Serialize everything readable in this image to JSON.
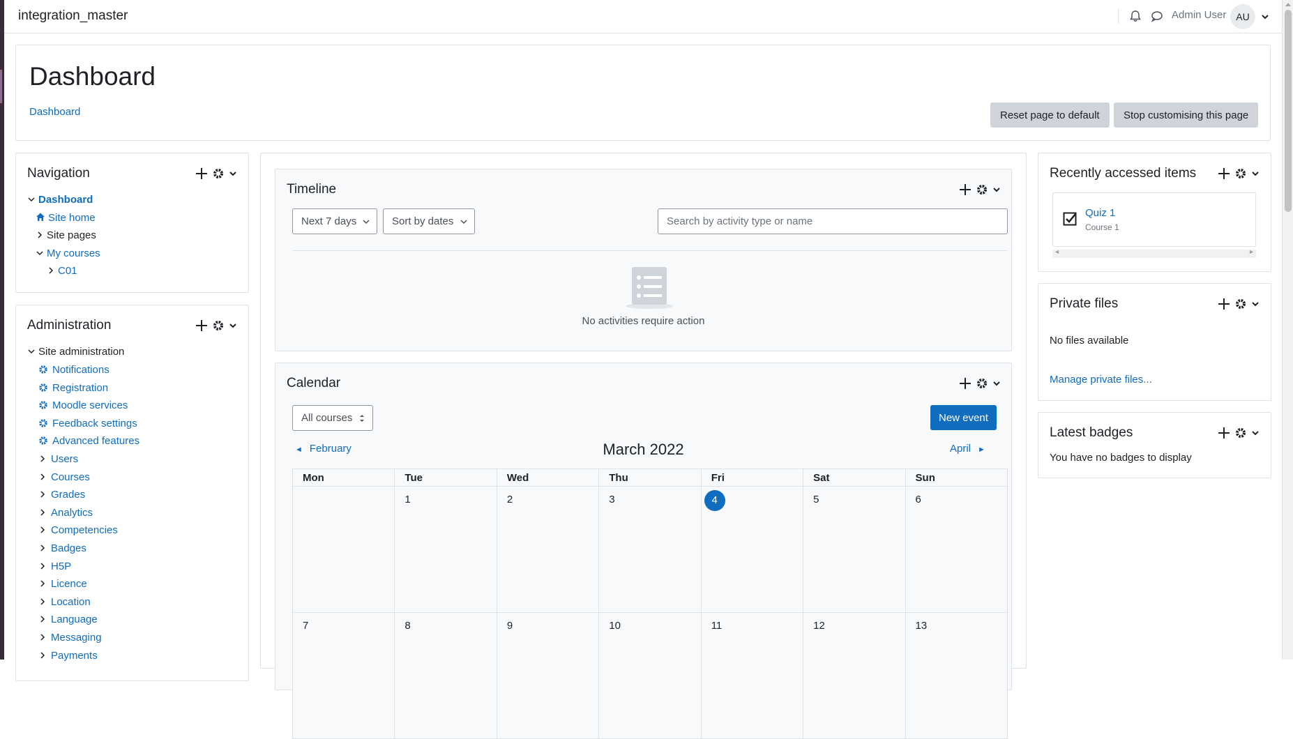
{
  "navbar": {
    "brand": "integration_master",
    "username": "Admin User",
    "avatar_initials": "AU"
  },
  "header": {
    "title": "Dashboard",
    "breadcrumb": "Dashboard",
    "reset_button": "Reset page to default",
    "stop_button": "Stop customising this page"
  },
  "navigation": {
    "title": "Navigation",
    "items": [
      {
        "label": "Dashboard"
      },
      {
        "label": "Site home"
      },
      {
        "label": "Site pages"
      },
      {
        "label": "My courses"
      },
      {
        "label": "C01"
      }
    ]
  },
  "administration": {
    "title": "Administration",
    "root": "Site administration",
    "items": [
      {
        "label": "Notifications",
        "icon": "gear-icon"
      },
      {
        "label": "Registration",
        "icon": "gear-icon"
      },
      {
        "label": "Moodle services",
        "icon": "gear-icon"
      },
      {
        "label": "Feedback settings",
        "icon": "gear-icon"
      },
      {
        "label": "Advanced features",
        "icon": "gear-icon"
      },
      {
        "label": "Users",
        "icon": "chevron-right-icon"
      },
      {
        "label": "Courses",
        "icon": "chevron-right-icon"
      },
      {
        "label": "Grades",
        "icon": "chevron-right-icon"
      },
      {
        "label": "Analytics",
        "icon": "chevron-right-icon"
      },
      {
        "label": "Competencies",
        "icon": "chevron-right-icon"
      },
      {
        "label": "Badges",
        "icon": "chevron-right-icon"
      },
      {
        "label": "H5P",
        "icon": "chevron-right-icon"
      },
      {
        "label": "Licence",
        "icon": "chevron-right-icon"
      },
      {
        "label": "Location",
        "icon": "chevron-right-icon"
      },
      {
        "label": "Language",
        "icon": "chevron-right-icon"
      },
      {
        "label": "Messaging",
        "icon": "chevron-right-icon"
      },
      {
        "label": "Payments",
        "icon": "chevron-right-icon"
      }
    ]
  },
  "timeline": {
    "title": "Timeline",
    "filter_label": "Next 7 days",
    "sort_label": "Sort by dates",
    "search_placeholder": "Search by activity type or name",
    "empty_text": "No activities require action"
  },
  "calendar": {
    "title": "Calendar",
    "course_filter": "All courses",
    "new_event": "New event",
    "prev_month": "February",
    "next_month": "April",
    "month_title": "March 2022",
    "weekdays": [
      "Mon",
      "Tue",
      "Wed",
      "Thu",
      "Fri",
      "Sat",
      "Sun"
    ],
    "weeks": [
      [
        "",
        "1",
        "2",
        "3",
        "4",
        "5",
        "6"
      ],
      [
        "7",
        "8",
        "9",
        "10",
        "11",
        "12",
        "13"
      ]
    ],
    "today": "4"
  },
  "recent": {
    "title": "Recently accessed items",
    "item_name": "Quiz 1",
    "item_course": "Course 1"
  },
  "private_files": {
    "title": "Private files",
    "empty_text": "No files available",
    "manage_link": "Manage private files..."
  },
  "badges": {
    "title": "Latest badges",
    "empty_text": "You have no badges to display"
  },
  "colors": {
    "accent": "#0f6cbf",
    "secondary_button": "#ced4da",
    "border": "#dee2e6"
  }
}
